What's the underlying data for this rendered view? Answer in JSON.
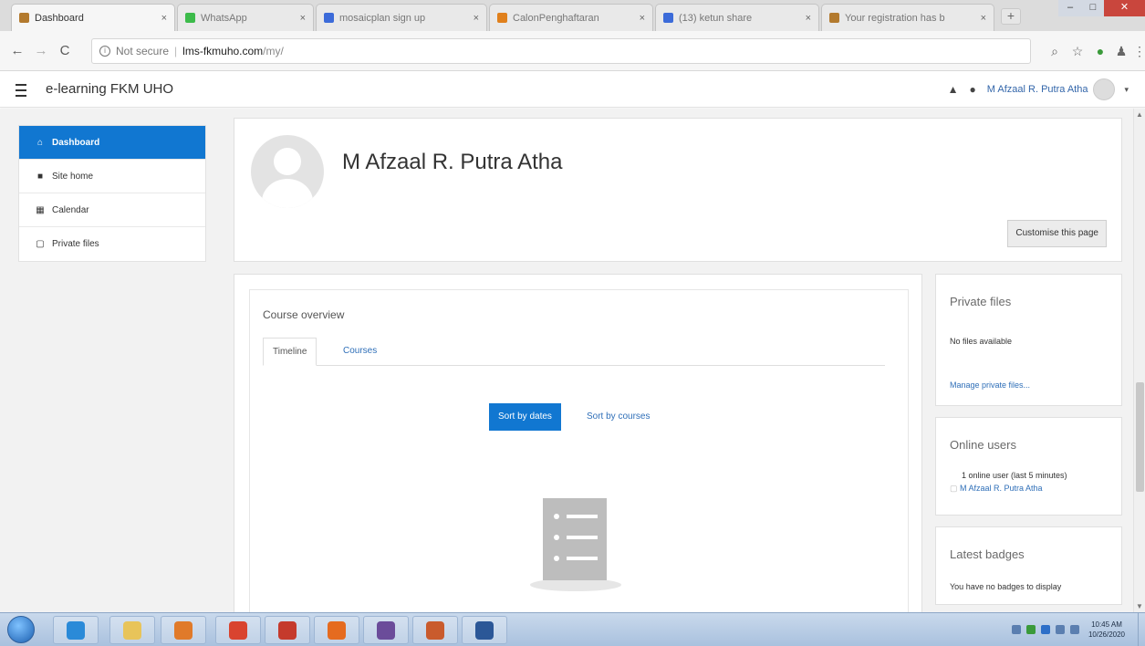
{
  "browser": {
    "tabs": [
      {
        "title": "Dashboard",
        "color": "#b37a2e",
        "active": true
      },
      {
        "title": "WhatsApp",
        "color": "#3cbb4a",
        "active": false
      },
      {
        "title": "mosaicplan sign up",
        "color": "#3c6bd9",
        "active": false
      },
      {
        "title": "CalonPenghaftaran",
        "color": "#e0801c",
        "active": false
      },
      {
        "title": "(13) ketun share",
        "color": "#3c6bd9",
        "active": false
      },
      {
        "title": "Your registration has b",
        "color": "#b37a2e",
        "active": false
      }
    ],
    "tab_close": "×",
    "new_tab": "+",
    "window": {
      "minimize": "–",
      "maximize": "□",
      "close": "✕"
    },
    "back": "←",
    "forward": "→",
    "reload": "C",
    "security_label": "Not secure",
    "url_host": "lms-fkmuho.com",
    "url_path": "/my/",
    "toolbar_icons": [
      "search-icon",
      "star-icon",
      "extension-icon",
      "account-icon",
      "menu-icon"
    ]
  },
  "navbar": {
    "site_name": "e-learning FKM UHO",
    "user_name": "M Afzaal R. Putra Atha",
    "caret": "▾"
  },
  "drawer": {
    "items": [
      {
        "label": "Dashboard",
        "icon": "home-icon",
        "glyph": "⌂",
        "active": true
      },
      {
        "label": "Site home",
        "icon": "site-home-icon",
        "glyph": "■",
        "active": false
      },
      {
        "label": "Calendar",
        "icon": "calendar-icon",
        "glyph": "▦",
        "active": false
      },
      {
        "label": "Private files",
        "icon": "file-icon",
        "glyph": "▢",
        "active": false
      }
    ]
  },
  "header": {
    "full_name": "M Afzaal R. Putra Atha",
    "customise_label": "Customise this page"
  },
  "course_overview": {
    "title": "Course overview",
    "tabs": [
      "Timeline",
      "Courses"
    ],
    "sort_by_dates": "Sort by dates",
    "sort_by_courses": "Sort by courses"
  },
  "blocks": {
    "private_files": {
      "title": "Private files",
      "text": "No files available",
      "link": "Manage private files..."
    },
    "online_users": {
      "title": "Online users",
      "text": "1 online user (last 5 minutes)",
      "user": "M Afzaal R. Putra Atha"
    },
    "latest_badges": {
      "title": "Latest badges",
      "text": "You have no badges to display"
    }
  },
  "taskbar": {
    "apps": [
      {
        "name": "ie",
        "color": "#2a8ad8"
      },
      {
        "name": "explorer",
        "color": "#e8c45a"
      },
      {
        "name": "media",
        "color": "#e07a2a"
      },
      {
        "name": "chrome",
        "color": "#d9442f"
      },
      {
        "name": "powerpoint-red",
        "color": "#c53a2c"
      },
      {
        "name": "firefox",
        "color": "#e56b1f"
      },
      {
        "name": "bow",
        "color": "#6b4c9a"
      },
      {
        "name": "pdf",
        "color": "#c95b2d"
      },
      {
        "name": "word",
        "color": "#2b5797"
      }
    ],
    "time": "10:45 AM",
    "date": "10/26/2020"
  }
}
